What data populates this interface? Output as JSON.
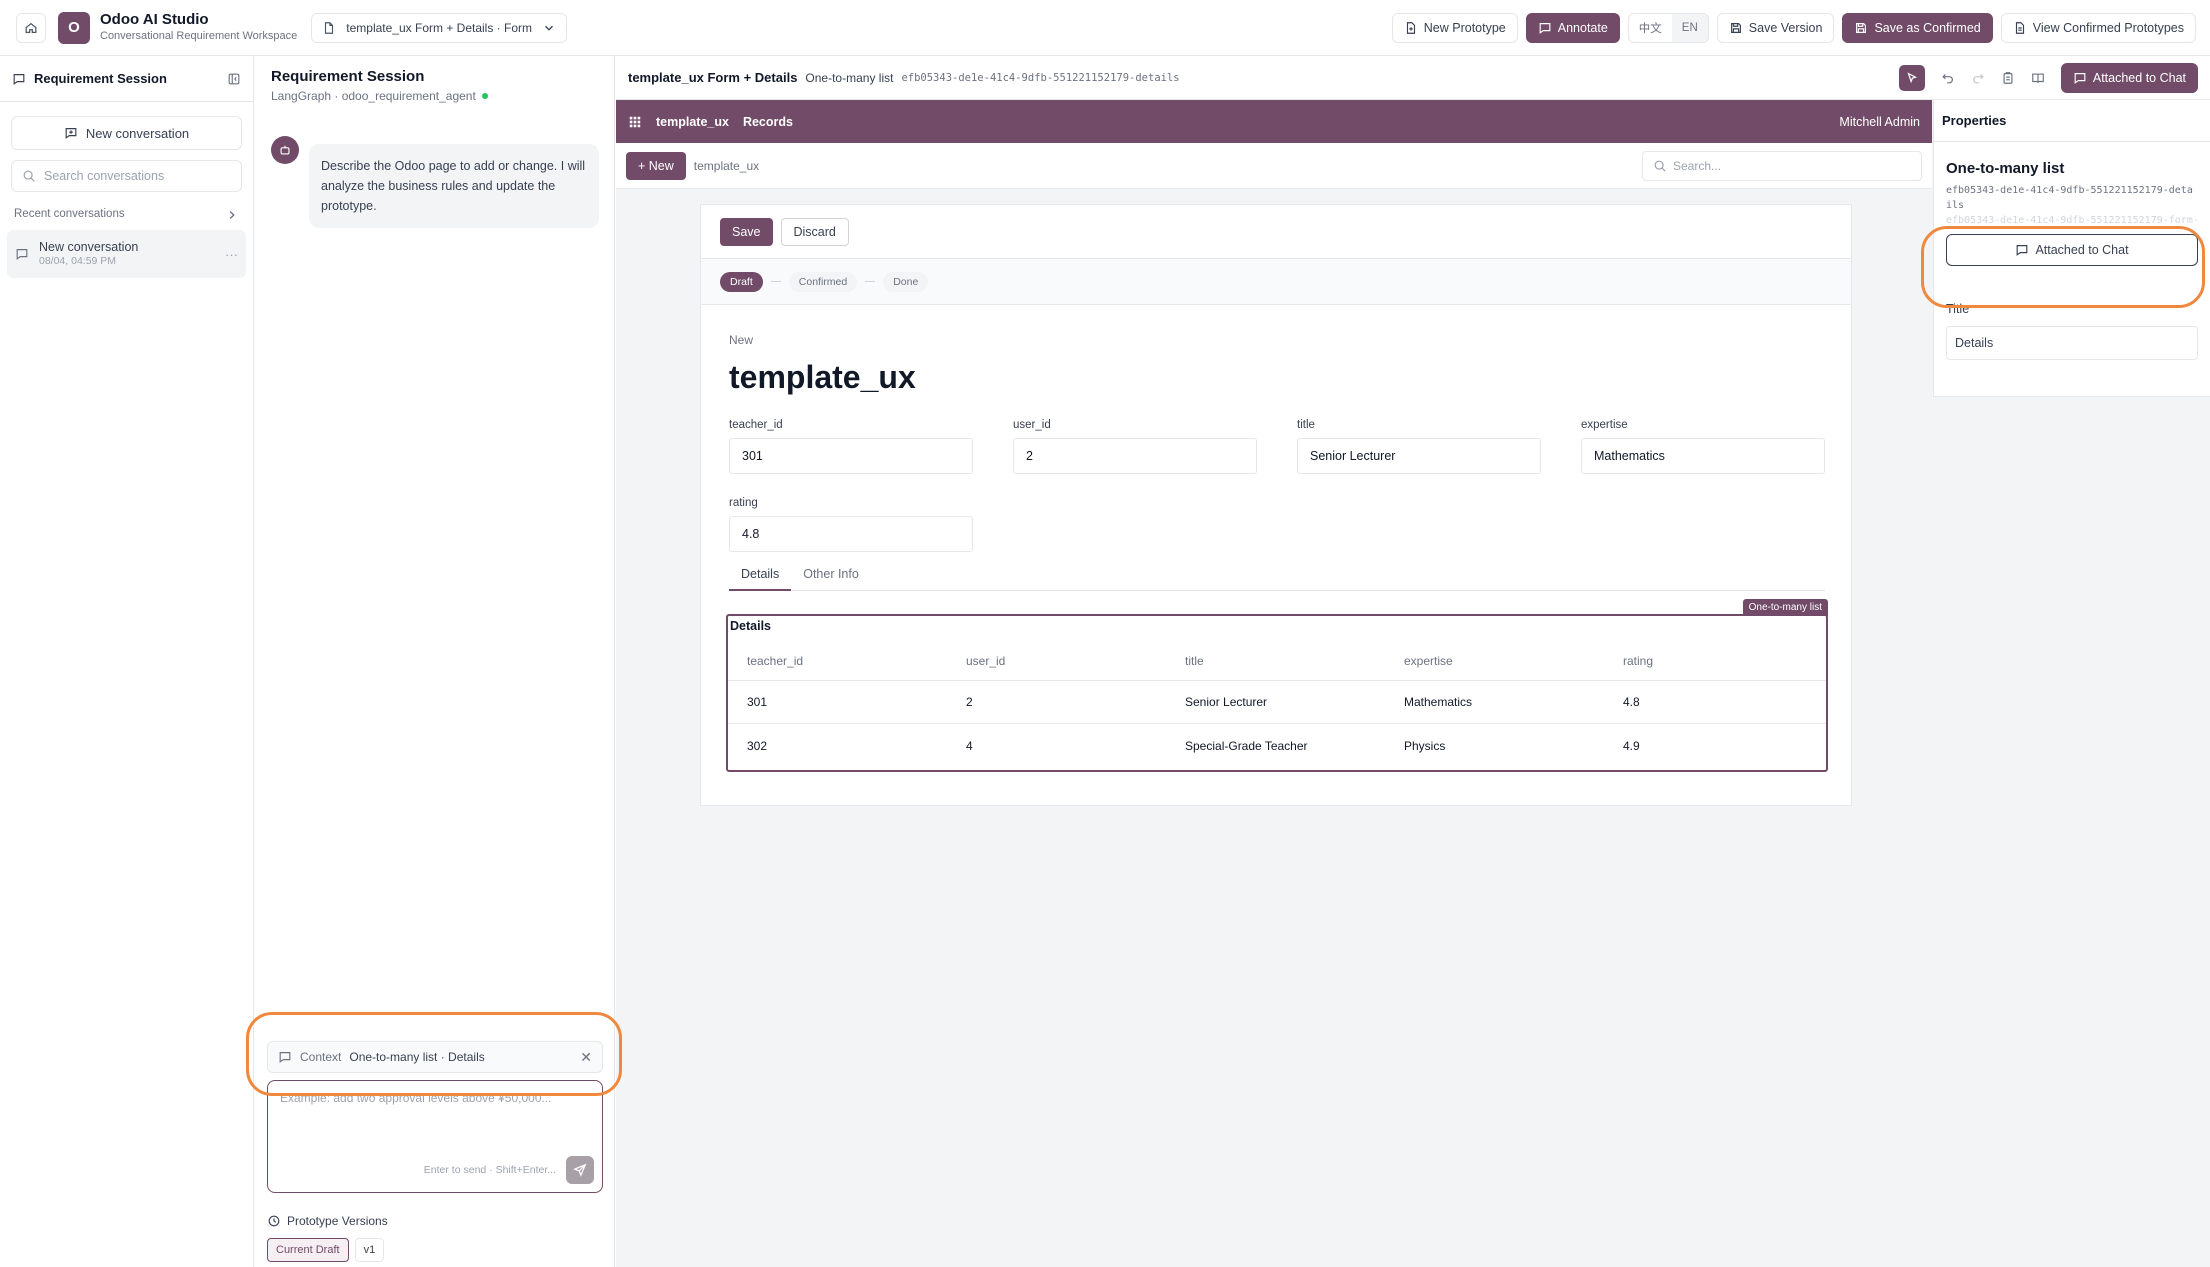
{
  "app": {
    "logo_letter": "O",
    "title": "Odoo AI Studio",
    "subtitle": "Conversational Requirement Workspace"
  },
  "doc_select": {
    "value": "template_ux Form + Details · Form"
  },
  "top_actions": {
    "new_prototype": "New Prototype",
    "annotate": "Annotate",
    "lang_zh": "中文",
    "lang_en": "EN",
    "save_version": "Save Version",
    "save_confirmed": "Save as Confirmed",
    "view_confirmed": "View Confirmed Prototypes"
  },
  "sidebar": {
    "title": "Requirement Session",
    "new_conversation": "New conversation",
    "search_placeholder": "Search conversations",
    "recent_label": "Recent conversations",
    "conversations": [
      {
        "title": "New conversation",
        "time": "08/04, 04:59 PM"
      }
    ]
  },
  "chat": {
    "title": "Requirement Session",
    "subtitle": "LangGraph · odoo_requirement_agent",
    "assistant_message": "Describe the Odoo page to add or change. I will analyze the business rules and update the prototype.",
    "context_label": "Context",
    "context_value": "One-to-many list · Details",
    "input_placeholder": "Example: add two approval levels above ¥50,000...",
    "send_hint": "Enter to send · Shift+Enter...",
    "versions_label": "Prototype Versions",
    "versions": [
      "Current Draft",
      "v1"
    ]
  },
  "canvas": {
    "title": "template_ux Form + Details",
    "selected": "One-to-many list",
    "selected_id": "efb05343-de1e-41c4-9dfb-551221152179-details",
    "attached_label": "Attached to Chat"
  },
  "odoo": {
    "app_name": "template_ux",
    "menu_records": "Records",
    "user": "Mitchell Admin",
    "new_button": "+ New",
    "breadcrumb": "template_ux",
    "search_placeholder": "Search...",
    "save": "Save",
    "discard": "Discard",
    "statuses": [
      "Draft",
      "Confirmed",
      "Done"
    ],
    "record_label": "New",
    "record_title": "template_ux",
    "fields": {
      "teacher_id": {
        "label": "teacher_id",
        "value": "301"
      },
      "user_id": {
        "label": "user_id",
        "value": "2"
      },
      "title": {
        "label": "title",
        "value": "Senior Lecturer"
      },
      "expertise": {
        "label": "expertise",
        "value": "Mathematics"
      },
      "rating": {
        "label": "rating",
        "value": "4.8"
      }
    },
    "tabs": [
      "Details",
      "Other Info"
    ],
    "o2m": {
      "tag": "One-to-many list",
      "title": "Details",
      "columns": [
        "teacher_id",
        "user_id",
        "title",
        "expertise",
        "rating"
      ],
      "rows": [
        [
          "301",
          "2",
          "Senior Lecturer",
          "Mathematics",
          "4.8"
        ],
        [
          "302",
          "4",
          "Special-Grade Teacher",
          "Physics",
          "4.9"
        ]
      ]
    }
  },
  "properties": {
    "header": "Properties",
    "name": "One-to-many list",
    "id": "efb05343-de1e-41c4-9dfb-551221152179-details",
    "ghost_id": "efb05343-de1e-41c4-9dfb-551221152179-form-se",
    "attached": "Attached to Chat",
    "title_label": "Title",
    "title_value": "Details"
  },
  "colors": {
    "accent": "#714b67",
    "highlight": "#f0883e"
  }
}
